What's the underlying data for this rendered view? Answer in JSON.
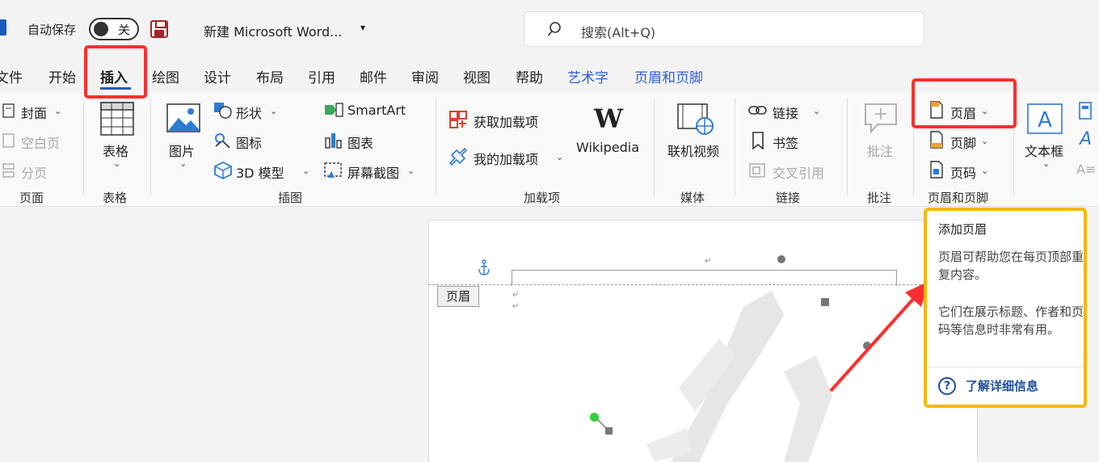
{
  "titlebar": {
    "autosave_label": "自动保存",
    "autosave_state": "关",
    "document_title": "新建 Microsoft Word...",
    "search_placeholder": "搜索(Alt+Q)"
  },
  "tabs": [
    {
      "label": "文件"
    },
    {
      "label": "开始"
    },
    {
      "label": "插入",
      "active": true
    },
    {
      "label": "绘图"
    },
    {
      "label": "设计"
    },
    {
      "label": "布局"
    },
    {
      "label": "引用"
    },
    {
      "label": "邮件"
    },
    {
      "label": "审阅"
    },
    {
      "label": "视图"
    },
    {
      "label": "帮助"
    },
    {
      "label": "艺术字",
      "contextual": true
    },
    {
      "label": "页眉和页脚",
      "contextual": true
    }
  ],
  "ribbon": {
    "pages": {
      "cover": "封面",
      "blank": "空白页",
      "break": "分页",
      "label": "页面"
    },
    "table": {
      "button": "表格",
      "label": "表格"
    },
    "illustrations": {
      "picture": "图片",
      "shapes": "形状",
      "icons": "图标",
      "model3d": "3D 模型",
      "smartart": "SmartArt",
      "chart": "图表",
      "screenshot": "屏幕截图",
      "label": "插图"
    },
    "addins": {
      "get": "获取加载项",
      "mine": "我的加载项",
      "wikipedia": "Wikipedia",
      "label": "加载项"
    },
    "media": {
      "video": "联机视频",
      "label": "媒体"
    },
    "links": {
      "link": "链接",
      "bookmark": "书签",
      "crossref": "交叉引用",
      "label": "链接"
    },
    "comments": {
      "comment": "批注",
      "label": "批注"
    },
    "header_footer": {
      "header": "页眉",
      "footer": "页脚",
      "page_number": "页码",
      "label": "页眉和页脚"
    },
    "text": {
      "textbox": "文本框"
    }
  },
  "document": {
    "header_tag": "页眉"
  },
  "tooltip": {
    "title": "添加页眉",
    "line1": "页眉可帮助您在每页顶部重复内容。",
    "line2": "它们在展示标题、作者和页码等信息时非常有用。",
    "link": "了解详细信息"
  },
  "colors": {
    "accent": "#185abd",
    "highlight_red": "#ff2e2e",
    "tooltip_border": "#f5b700",
    "contextual_tab": "#2b5fd9"
  }
}
